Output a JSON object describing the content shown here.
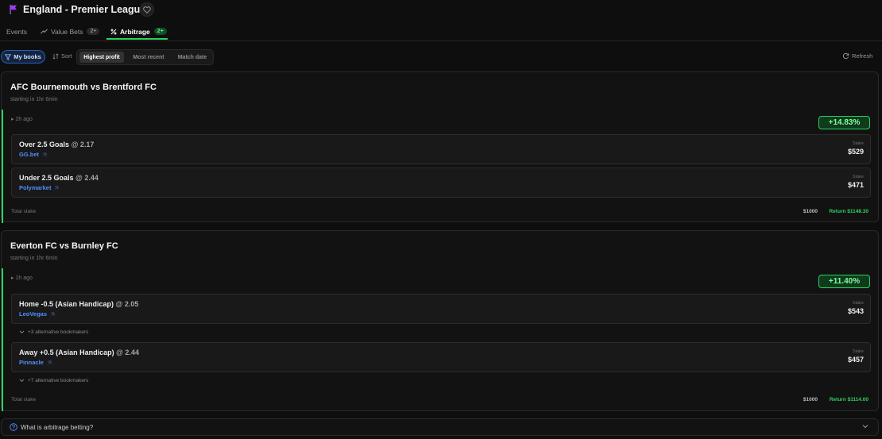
{
  "header": {
    "title": "England - Premier League",
    "flag_icon": "flag-icon",
    "favorite_icon": "heart-icon"
  },
  "tabs": [
    {
      "label": "Events",
      "badge": ""
    },
    {
      "label": "Value Bets",
      "badge": "2+",
      "icon": "trend-icon"
    },
    {
      "label": "Arbitrage",
      "badge": "2+",
      "icon": "percent-icon",
      "active": true
    }
  ],
  "toolbar": {
    "my_books_label": "My books",
    "sort_label": "Sort",
    "sort_options": [
      "Highest profit",
      "Most recent",
      "Match date"
    ],
    "sort_selected": "Highest profit",
    "refresh_label": "Refresh"
  },
  "events": [
    {
      "title": "AFC Bournemouth vs Brentford FC",
      "starting": "starting in 1hr 6min",
      "ago": "2h ago",
      "profit": "+14.83%",
      "legs": [
        {
          "market": "Over 2.5 Goals",
          "odds": "@ 2.17",
          "book": "GG.bet",
          "stake_label": "Stake",
          "stake": "$529",
          "alt": ""
        },
        {
          "market": "Under 2.5 Goals",
          "odds": "@ 2.44",
          "book": "Polymarket",
          "stake_label": "Stake",
          "stake": "$471",
          "alt": ""
        }
      ],
      "total_label": "Total stake",
      "total_stake": "$1000",
      "total_return": "Return $1148.30"
    },
    {
      "title": "Everton FC vs Burnley FC",
      "starting": "starting in 1hr 6min",
      "ago": "1h ago",
      "profit": "+11.40%",
      "legs": [
        {
          "market": "Home -0.5 (Asian Handicap)",
          "odds": "@ 2.05",
          "book": "LeoVegas",
          "stake_label": "Stake",
          "stake": "$543",
          "alt": "+3 alternative bookmakers"
        },
        {
          "market": "Away +0.5 (Asian Handicap)",
          "odds": "@ 2.44",
          "book": "Pinnacle",
          "stake_label": "Stake",
          "stake": "$457",
          "alt": "+7 alternative bookmakers"
        }
      ],
      "total_label": "Total stake",
      "total_stake": "$1000",
      "total_return": "Return $1114.00"
    }
  ],
  "faq": {
    "question": "What is arbitrage betting?"
  },
  "colors": {
    "accent_green": "#2fd15e",
    "link_blue": "#4f8fff",
    "background": "#0e0e0e"
  }
}
